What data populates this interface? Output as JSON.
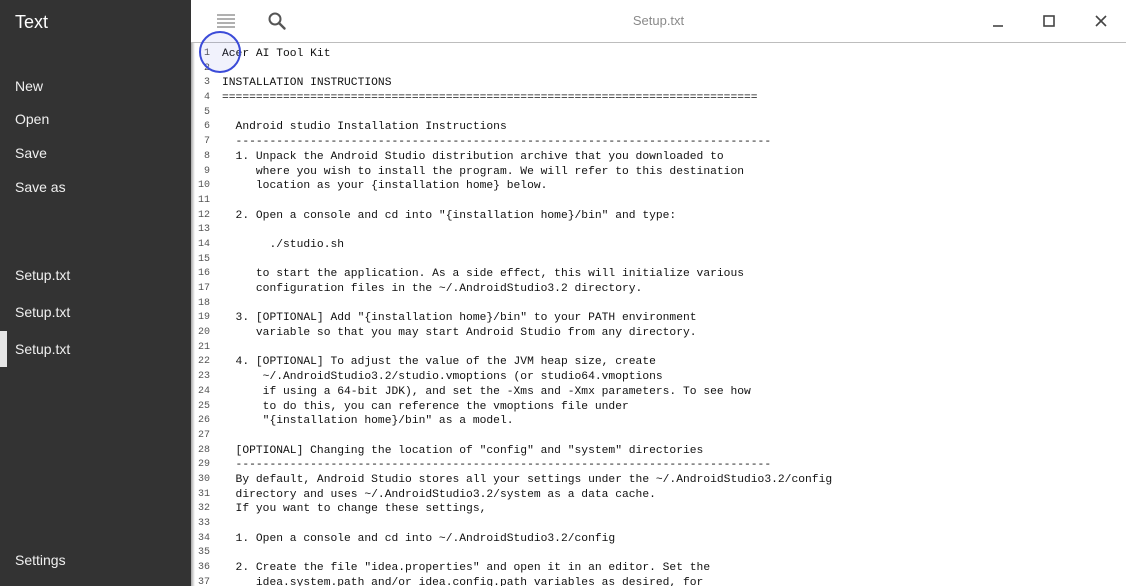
{
  "sidebar": {
    "app_title": "Text",
    "menu": [
      {
        "label": "New"
      },
      {
        "label": "Open"
      },
      {
        "label": "Save"
      },
      {
        "label": "Save as"
      }
    ],
    "files": [
      {
        "label": "Setup.txt"
      },
      {
        "label": "Setup.txt"
      },
      {
        "label": "Setup.txt"
      }
    ],
    "settings_label": "Settings"
  },
  "header": {
    "title": "Setup.txt",
    "icons": [
      "menu-icon",
      "search-icon",
      "minimize-icon",
      "maximize-icon",
      "close-icon"
    ]
  },
  "editor": {
    "lines": [
      "Acer AI Tool Kit",
      "",
      "INSTALLATION INSTRUCTIONS",
      "===============================================================================",
      "",
      "  Android studio Installation Instructions",
      "  -------------------------------------------------------------------------------",
      "  1. Unpack the Android Studio distribution archive that you downloaded to",
      "     where you wish to install the program. We will refer to this destination",
      "     location as your {installation home} below.",
      "",
      "  2. Open a console and cd into \"{installation home}/bin\" and type:",
      "",
      "       ./studio.sh",
      "",
      "     to start the application. As a side effect, this will initialize various",
      "     configuration files in the ~/.AndroidStudio3.2 directory.",
      "",
      "  3. [OPTIONAL] Add \"{installation home}/bin\" to your PATH environment",
      "     variable so that you may start Android Studio from any directory.",
      "",
      "  4. [OPTIONAL] To adjust the value of the JVM heap size, create",
      "      ~/.AndroidStudio3.2/studio.vmoptions (or studio64.vmoptions",
      "      if using a 64-bit JDK), and set the -Xms and -Xmx parameters. To see how",
      "      to do this, you can reference the vmoptions file under",
      "      \"{installation home}/bin\" as a model.",
      "",
      "  [OPTIONAL] Changing the location of \"config\" and \"system\" directories",
      "  -------------------------------------------------------------------------------",
      "  By default, Android Studio stores all your settings under the ~/.AndroidStudio3.2/config",
      "  directory and uses ~/.AndroidStudio3.2/system as a data cache.",
      "  If you want to change these settings,",
      "",
      "  1. Open a console and cd into ~/.AndroidStudio3.2/config",
      "",
      "  2. Create the file \"idea.properties\" and open it in an editor. Set the",
      "     idea.system.path and/or idea.config.path variables as desired, for"
    ]
  }
}
